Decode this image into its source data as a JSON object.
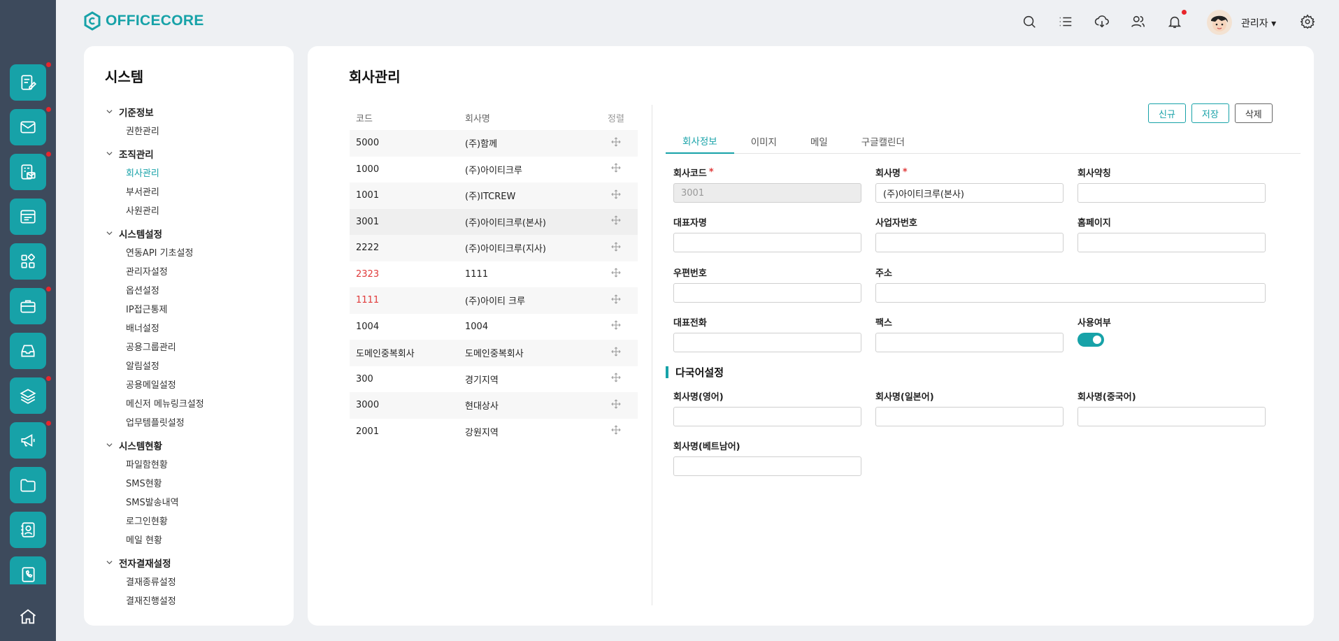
{
  "brand": {
    "name": "OFFICECORE",
    "color": "#17a2a8"
  },
  "header": {
    "icons": [
      "search-icon",
      "list-icon",
      "cloud-download-icon",
      "users-icon",
      "bell-icon",
      "gear-icon"
    ],
    "user_name": "관리자 ▾"
  },
  "rail": {
    "icons": [
      "edit-icon",
      "mail-icon",
      "approval-icon",
      "board-icon",
      "apps-icon",
      "briefcase-icon",
      "inbox-icon",
      "layers-icon",
      "megaphone-icon",
      "folder-icon",
      "contacts-icon",
      "phonebook-icon",
      "home-icon"
    ]
  },
  "sidebar": {
    "title": "시스템",
    "groups": [
      {
        "label": "기준정보",
        "items": [
          "권한관리"
        ]
      },
      {
        "label": "조직관리",
        "items": [
          "회사관리",
          "부서관리",
          "사원관리"
        ]
      },
      {
        "label": "시스템설정",
        "items": [
          "연동API 기초설정",
          "관리자설정",
          "옵션설정",
          "IP접근통제",
          "배너설정",
          "공용그룹관리",
          "알림설정",
          "공용메일설정",
          "메신저 메뉴링크설정",
          "업무템플릿설정"
        ]
      },
      {
        "label": "시스템현황",
        "items": [
          "파일함현황",
          "SMS현황",
          "SMS발송내역",
          "로그인현황",
          "메일 현황"
        ]
      },
      {
        "label": "전자결재설정",
        "items": [
          "결재종류설정",
          "결재진행설정"
        ]
      }
    ]
  },
  "main": {
    "title": "회사관리",
    "table": {
      "headers": {
        "code": "코드",
        "name": "회사명",
        "sort": "정렬"
      },
      "rows": [
        {
          "code": "5000",
          "name": "(주)함께"
        },
        {
          "code": "1000",
          "name": "(주)아이티크루"
        },
        {
          "code": "1001",
          "name": "(주)ITCREW"
        },
        {
          "code": "3001",
          "name": "(주)아이티크루(본사)"
        },
        {
          "code": "2222",
          "name": "(주)아이티크루(지사)"
        },
        {
          "code": "2323",
          "name": "1111"
        },
        {
          "code": "1111",
          "name": "(주)아이티 크루"
        },
        {
          "code": "1004",
          "name": "1004"
        },
        {
          "code": "도메인중복회사",
          "name": "도메인중복회사"
        },
        {
          "code": "300",
          "name": "경기지역"
        },
        {
          "code": "3000",
          "name": "현대상사"
        },
        {
          "code": "2001",
          "name": "강원지역"
        }
      ]
    },
    "buttons": {
      "new": "신규",
      "save": "저장",
      "delete": "삭제"
    },
    "tabs": [
      "회사정보",
      "이미지",
      "메일",
      "구글캘린더"
    ],
    "form": {
      "company_code": {
        "label": "회사코드",
        "required": "*",
        "value": "3001"
      },
      "company_name": {
        "label": "회사명",
        "required": "*",
        "value": "(주)아이티크루(본사)"
      },
      "company_abbr": {
        "label": "회사약칭",
        "value": ""
      },
      "ceo_name": {
        "label": "대표자명",
        "value": ""
      },
      "business_no": {
        "label": "사업자번호",
        "value": ""
      },
      "homepage": {
        "label": "홈페이지",
        "value": ""
      },
      "zipcode": {
        "label": "우편번호",
        "value": ""
      },
      "address": {
        "label": "주소",
        "value": ""
      },
      "phone": {
        "label": "대표전화",
        "value": ""
      },
      "fax": {
        "label": "팩스",
        "value": ""
      },
      "use_yn": {
        "label": "사용여부",
        "on": true
      }
    },
    "multilang": {
      "title": "다국어설정",
      "en": {
        "label": "회사명(영어)",
        "value": ""
      },
      "ja": {
        "label": "회사명(일본어)",
        "value": ""
      },
      "zh": {
        "label": "회사명(중국어)",
        "value": ""
      },
      "vi": {
        "label": "회사명(베트남어)",
        "value": ""
      }
    }
  }
}
